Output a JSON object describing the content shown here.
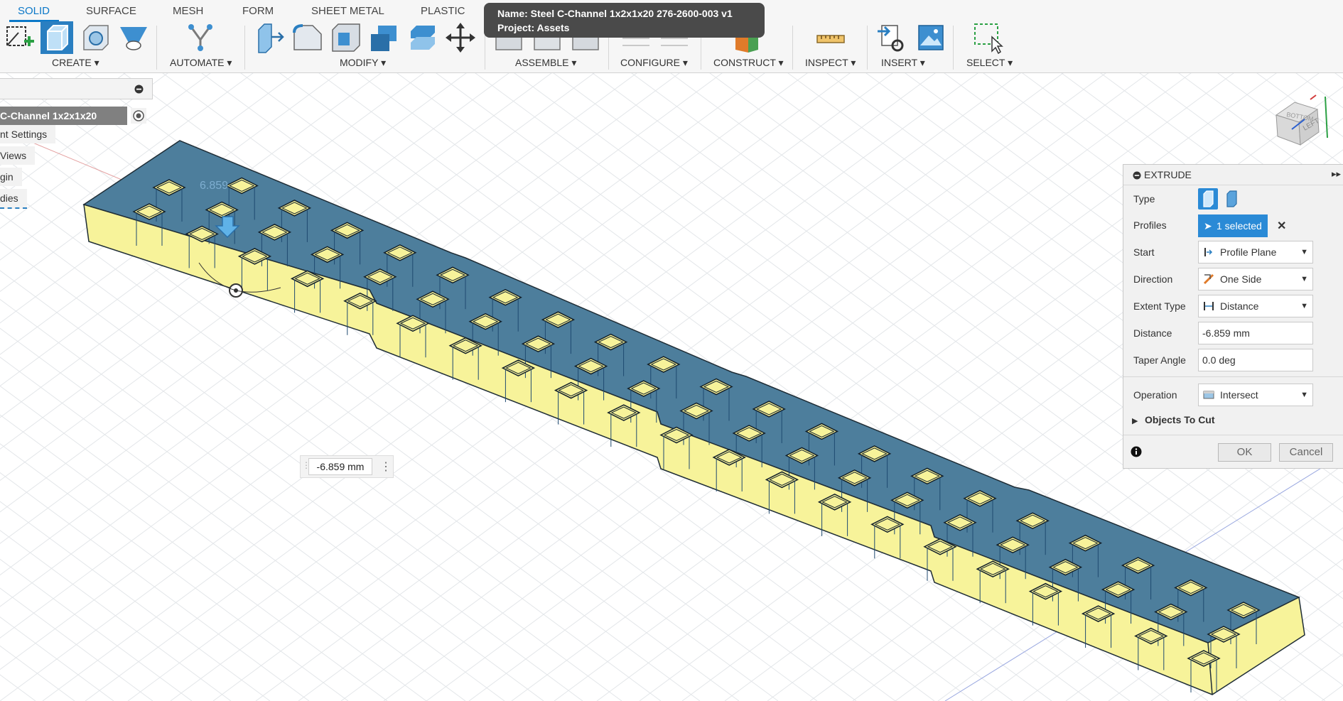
{
  "tabs": [
    "SOLID",
    "SURFACE",
    "MESH",
    "FORM",
    "SHEET METAL",
    "PLASTIC"
  ],
  "groups": {
    "create": "CREATE ▾",
    "automate": "AUTOMATE ▾",
    "modify": "MODIFY ▾",
    "assemble": "ASSEMBLE ▾",
    "configure": "CONFIGURE ▾",
    "construct": "CONSTRUCT ▾",
    "inspect": "INSPECT ▾",
    "insert": "INSERT ▾",
    "select": "SELECT ▾"
  },
  "tooltip": {
    "name": "Name: Steel C-Channel 1x2x1x20 276-2600-003 v1",
    "project": "Project: Assets"
  },
  "browser": {
    "items": [
      "C-Channel 1x2x1x20 276-...",
      "nt Settings",
      "Views",
      "gin",
      "dies"
    ]
  },
  "model": {
    "dimension_label": "6.859"
  },
  "viewcube": {
    "face_left": "LEFT",
    "face_top": "BOTTOM"
  },
  "extrude": {
    "title": "EXTRUDE",
    "type_label": "Type",
    "profiles_label": "Profiles",
    "profiles_value": "1 selected",
    "start_label": "Start",
    "start_value": "Profile Plane",
    "direction_label": "Direction",
    "direction_value": "One Side",
    "extent_label": "Extent Type",
    "extent_value": "Distance",
    "distance_label": "Distance",
    "distance_value": "-6.859 mm",
    "taper_label": "Taper Angle",
    "taper_value": "0.0 deg",
    "operation_label": "Operation",
    "operation_value": "Intersect",
    "objects_to_cut": "Objects To Cut",
    "ok": "OK",
    "cancel": "Cancel"
  },
  "measure_input": "-6.859 mm",
  "colors": {
    "accent": "#0b78c8",
    "top_face": "#4d7e9c",
    "side_face": "#f7f39a"
  }
}
